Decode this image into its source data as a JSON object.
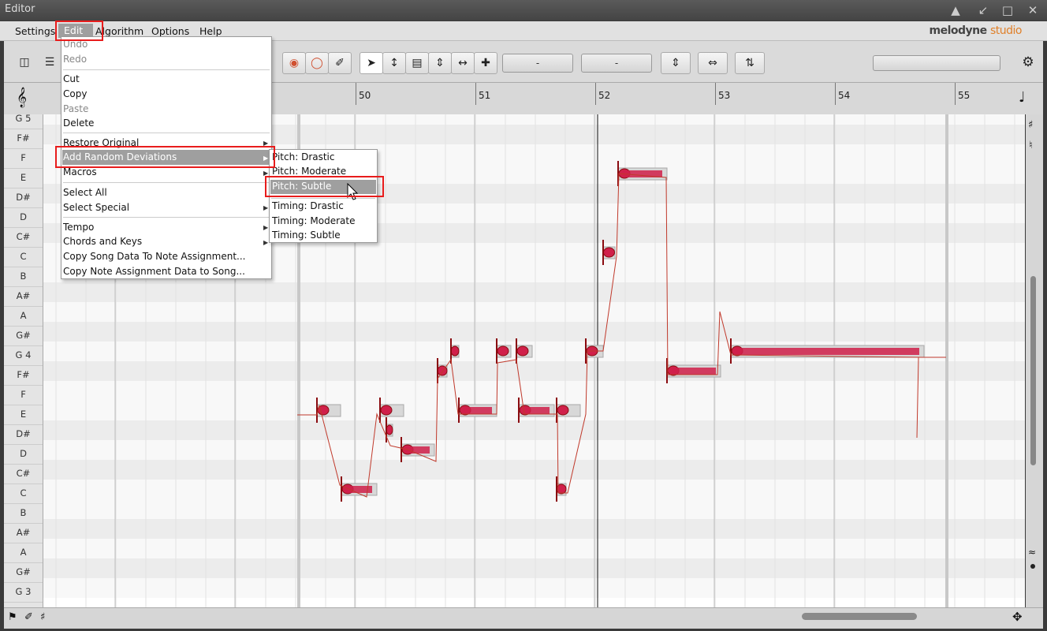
{
  "window": {
    "title": "Editor"
  },
  "menubar": {
    "items": [
      "Settings",
      "Edit",
      "Algorithm",
      "Options",
      "Help"
    ],
    "logo_main": "melodyne",
    "logo_sub": "studio"
  },
  "toolbar": {
    "field1": "-",
    "field2": "-"
  },
  "ruler": {
    "bars": [
      "50",
      "51",
      "52",
      "53",
      "54",
      "55"
    ]
  },
  "keys": [
    "G 5",
    "F#",
    "F",
    "E",
    "D#",
    "D",
    "C#",
    "C",
    "B",
    "A#",
    "A",
    "G#",
    "G 4",
    "F#",
    "F",
    "E",
    "D#",
    "D",
    "C#",
    "C",
    "B",
    "A#",
    "A",
    "G#",
    "G 3"
  ],
  "edit_menu": {
    "undo": "Undo",
    "redo": "Redo",
    "cut": "Cut",
    "copy": "Copy",
    "paste": "Paste",
    "delete": "Delete",
    "restore_original": "Restore Original",
    "add_random_deviations": "Add Random Deviations",
    "macros": "Macros",
    "select_all": "Select All",
    "select_special": "Select Special",
    "tempo": "Tempo",
    "chords_and_keys": "Chords and Keys",
    "copy_song_data": "Copy Song Data To Note Assignment...",
    "copy_note_data": "Copy Note Assignment Data to Song..."
  },
  "submenu": {
    "pitch_drastic": "Pitch: Drastic",
    "pitch_moderate": "Pitch: Moderate",
    "pitch_subtle": "Pitch: Subtle",
    "timing_drastic": "Timing: Drastic",
    "timing_moderate": "Timing: Moderate",
    "timing_subtle": "Timing: Subtle"
  },
  "colors": {
    "note_fill": "#d0204a",
    "note_outline": "#8a0b10",
    "highlight_box": "#e81c1c",
    "menu_highlight": "#9f9f9f"
  }
}
